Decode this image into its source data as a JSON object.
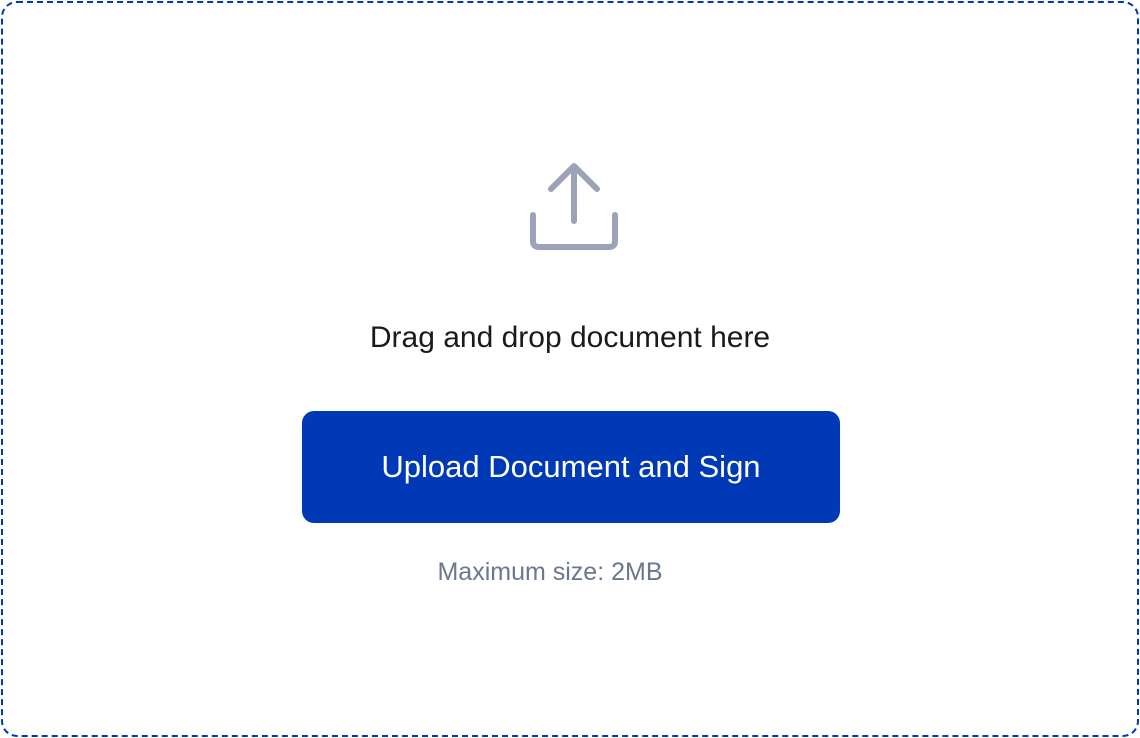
{
  "dropzone": {
    "icon": "upload-icon",
    "prompt": "Drag and drop document here",
    "button_label": "Upload Document and Sign",
    "size_note": "Maximum size: 2MB"
  },
  "colors": {
    "accent": "#0039b5",
    "icon": "#9ca3b8",
    "prompt_text": "#1a1a1a",
    "note_text": "#6b7790"
  }
}
